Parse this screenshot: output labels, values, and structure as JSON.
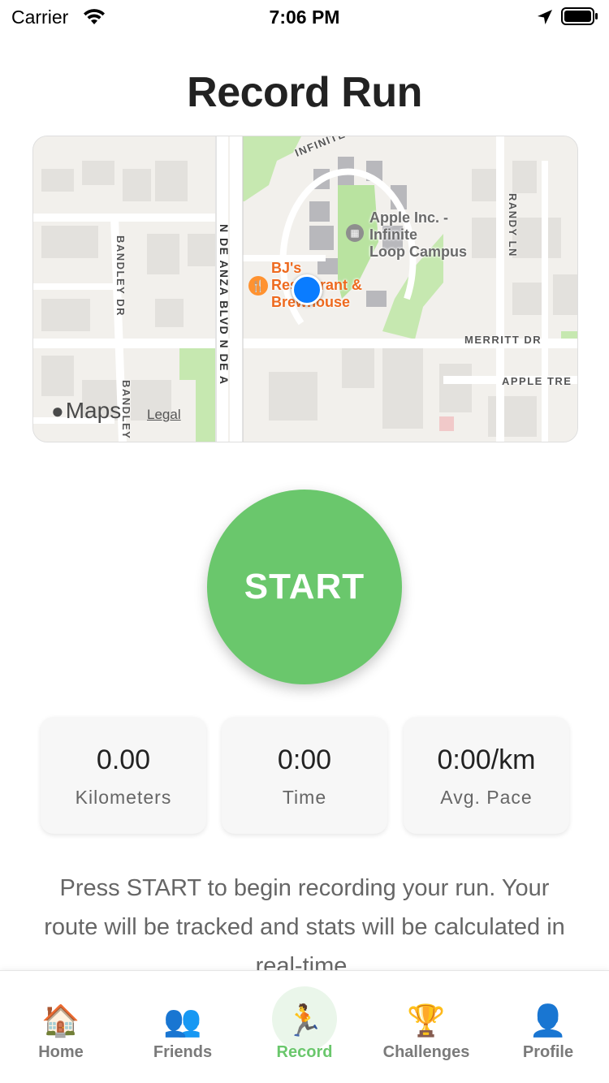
{
  "status_bar": {
    "carrier": "Carrier",
    "time": "7:06 PM"
  },
  "page": {
    "title": "Record Run"
  },
  "map": {
    "poi_apple": "Apple Inc. -\nInfinite\nLoop Campus",
    "poi_restaurant": "BJ's\nRestaurant &\nBrewhouse",
    "streets": {
      "infinite_loop": "INFINITE LOOP",
      "randy_ln": "RANDY LN",
      "bandley_dr": "BANDLEY DR",
      "bandley_dr_2": "BANDLEY",
      "de_anza": "N DE ANZA BLVD  N DE A",
      "merritt_dr": "MERRITT DR",
      "apple_tree": "APPLE TRE"
    },
    "attribution_logo": "Maps",
    "legal": "Legal",
    "colors": {
      "land": "#f2f0ec",
      "park": "#b9e3a0",
      "building": "#e3e1dd",
      "road": "#ffffff",
      "location": "#0a7cff"
    }
  },
  "start_button": {
    "label": "START",
    "color": "#6ac76c"
  },
  "stats": [
    {
      "value": "0.00",
      "label": "Kilometers"
    },
    {
      "value": "0:00",
      "label": "Time"
    },
    {
      "value": "0:00/km",
      "label": "Avg. Pace"
    }
  ],
  "instructions": "Press START to begin recording your run. Your route will be tracked and stats will be calculated in real-time.",
  "tab_bar": {
    "active": "Record",
    "items": [
      {
        "label": "Home",
        "icon": "house-icon",
        "glyph": "🏠"
      },
      {
        "label": "Friends",
        "icon": "friends-icon",
        "glyph": "👥"
      },
      {
        "label": "Record",
        "icon": "runner-icon",
        "glyph": "🏃"
      },
      {
        "label": "Challenges",
        "icon": "trophy-icon",
        "glyph": "🏆"
      },
      {
        "label": "Profile",
        "icon": "profile-icon",
        "glyph": "👤"
      }
    ]
  }
}
